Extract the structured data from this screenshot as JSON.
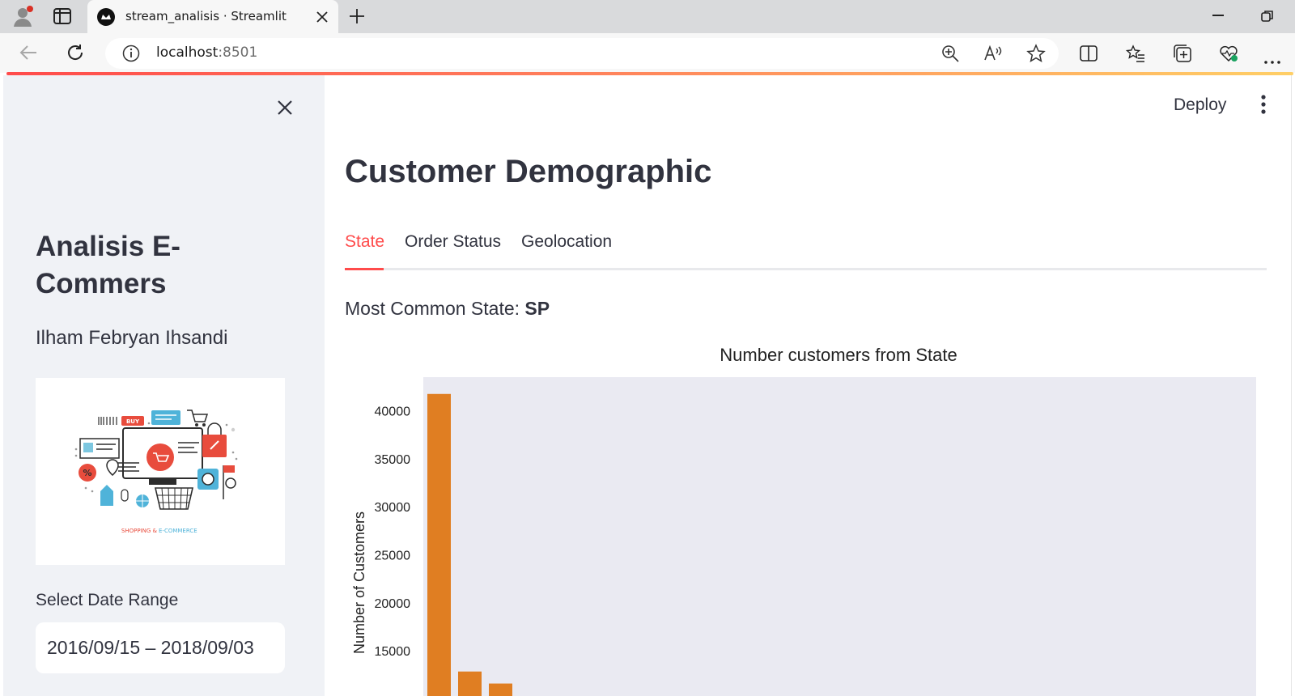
{
  "browser": {
    "tab_title": "stream_analisis · Streamlit",
    "url_host": "localhost",
    "url_port": ":8501"
  },
  "header": {
    "deploy_label": "Deploy"
  },
  "sidebar": {
    "title": "Analisis E-Commers",
    "author": "Ilham Febryan Ihsandi",
    "image_caption_left": "SHOPPING &",
    "image_caption_right": "E-COMMERCE",
    "date_label": "Select Date Range",
    "date_value": "2016/09/15 – 2018/09/03"
  },
  "main": {
    "title": "Customer Demographic",
    "tabs": [
      {
        "label": "State",
        "active": true
      },
      {
        "label": "Order Status",
        "active": false
      },
      {
        "label": "Geolocation",
        "active": false
      }
    ],
    "most_common_label": "Most Common State:",
    "most_common_value": "SP"
  },
  "chart_data": {
    "type": "bar",
    "title": "Number customers from State",
    "xlabel": "",
    "ylabel": "Number of Customers",
    "values": [
      41750,
      12850,
      11600
    ],
    "y_ticks": [
      15000,
      20000,
      25000,
      30000,
      35000,
      40000
    ],
    "ylim": [
      10300,
      43500
    ],
    "bar_color": "#e07e22",
    "background_color": "#eaeaf2",
    "grid": false
  },
  "colors": {
    "accent": "#ff4b4b",
    "sidebar_bg": "#f0f2f6",
    "text": "#31333f"
  }
}
